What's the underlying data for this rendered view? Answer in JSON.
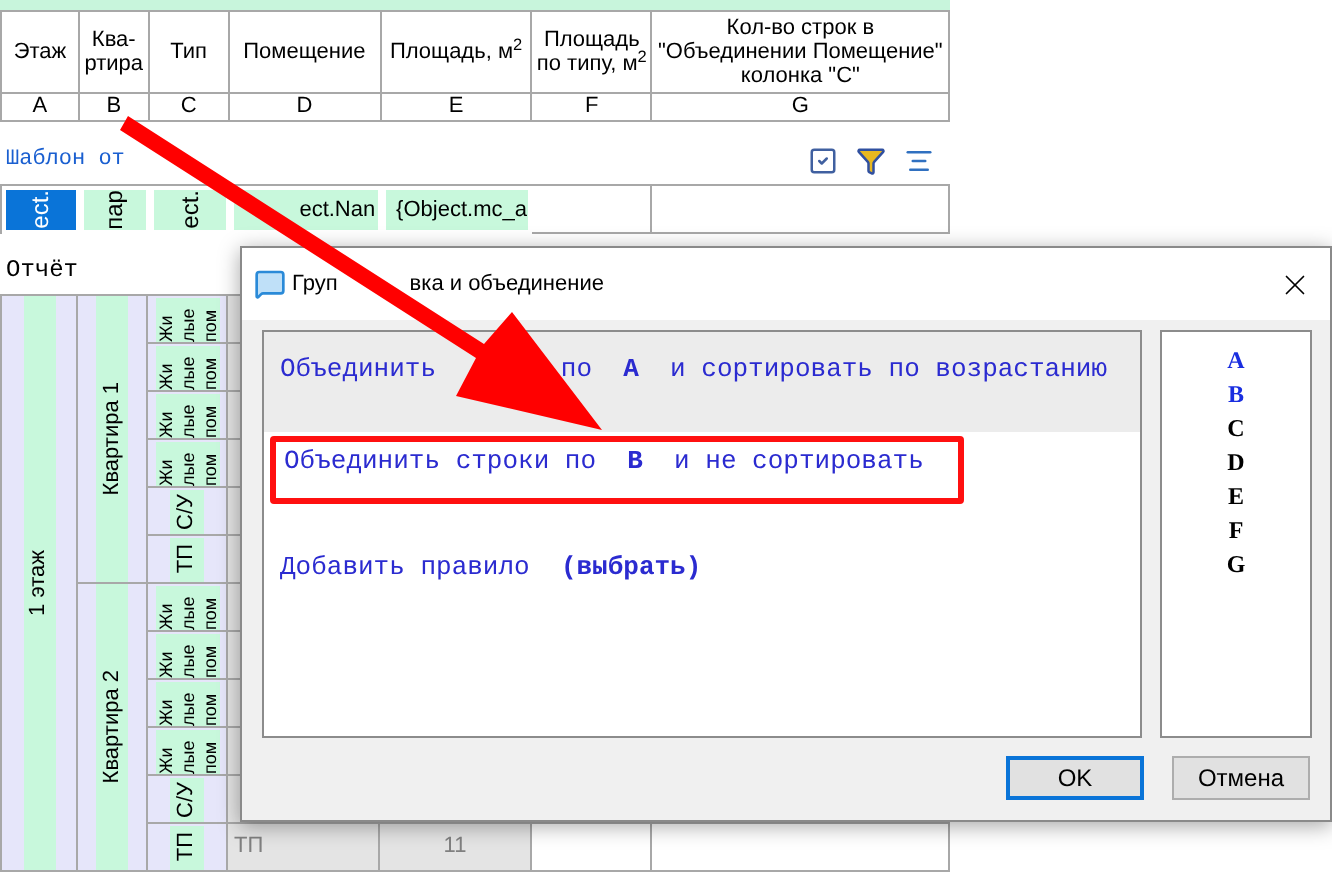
{
  "header_columns": [
    {
      "title": "Этаж",
      "letter": "A"
    },
    {
      "title": "Ква-ртира",
      "letter": "B"
    },
    {
      "title": "Тип",
      "letter": "C"
    },
    {
      "title": "Помещение",
      "letter": "D"
    },
    {
      "title": "Площадь, м$^{2}$",
      "letter": "E"
    },
    {
      "title": "Площадь по типу, м$^{2}$",
      "letter": "F"
    },
    {
      "title": "Кол-во строк в \"Объединении Помещение\" колонка \"С\"",
      "letter": "G"
    }
  ],
  "template": {
    "title": "Шаблон от",
    "cells": [
      {
        "text": "ect.",
        "kind": "vertical",
        "selected": true
      },
      {
        "text": "пар",
        "kind": "vertical",
        "selected": false
      },
      {
        "text": "ect.",
        "kind": "vertical",
        "selected": false
      },
      {
        "text": "ect.Nan",
        "kind": "horizontal",
        "selected": false
      },
      {
        "text": "{Object.mc_a",
        "kind": "horizontal",
        "selected": false
      }
    ]
  },
  "report": {
    "title": "Отчёт",
    "floor": "1 этаж",
    "apartments": [
      {
        "name": "Квартира 1",
        "rooms": [
          {
            "kind": "residential",
            "type_lines": [
              "Жи",
              "лые",
              "пом"
            ]
          },
          {
            "kind": "residential",
            "type_lines": [
              "Жи",
              "лые",
              "пом"
            ]
          },
          {
            "kind": "residential",
            "type_lines": [
              "Жи",
              "лые",
              "пом"
            ]
          },
          {
            "kind": "residential",
            "type_lines": [
              "Жи",
              "лые",
              "пом"
            ]
          },
          {
            "kind": "service",
            "type": "С/У"
          },
          {
            "kind": "service",
            "type": "ТП"
          }
        ]
      },
      {
        "name": "Квартира 2",
        "rooms": [
          {
            "kind": "residential",
            "type_lines": [
              "Жи",
              "лые",
              "пом"
            ]
          },
          {
            "kind": "residential",
            "type_lines": [
              "Жи",
              "лые",
              "пом"
            ]
          },
          {
            "kind": "residential",
            "type_lines": [
              "Жи",
              "лые",
              "пом"
            ]
          },
          {
            "kind": "residential",
            "type_lines": [
              "Жи",
              "лые",
              "пом"
            ]
          },
          {
            "kind": "service",
            "type": "С/У"
          },
          {
            "kind": "service",
            "type": "ТП",
            "room": "ТП",
            "area": "11"
          }
        ]
      }
    ]
  },
  "dialog": {
    "title_parts": [
      "Груп",
      "вка и объединение"
    ],
    "rules": [
      {
        "kind": "rule",
        "parts": [
          "Объединить",
          "по  **A**  и сортировать по возрастанию"
        ],
        "selected": true,
        "annotated": false
      },
      {
        "kind": "rule",
        "parts": [
          "Объединить строки по  **B**  и не сортировать"
        ],
        "selected": false,
        "annotated": true
      },
      {
        "kind": "add",
        "parts": [
          "Добавить правило  **(выбрать)**"
        ],
        "selected": false,
        "annotated": false
      }
    ],
    "columns": [
      {
        "letter": "A",
        "used": true
      },
      {
        "letter": "B",
        "used": true
      },
      {
        "letter": "C",
        "used": false
      },
      {
        "letter": "D",
        "used": false
      },
      {
        "letter": "E",
        "used": false
      },
      {
        "letter": "F",
        "used": false
      },
      {
        "letter": "G",
        "used": false
      }
    ],
    "buttons": [
      {
        "label": "OK",
        "focused": true
      },
      {
        "label": "Отмена",
        "focused": false
      }
    ]
  }
}
